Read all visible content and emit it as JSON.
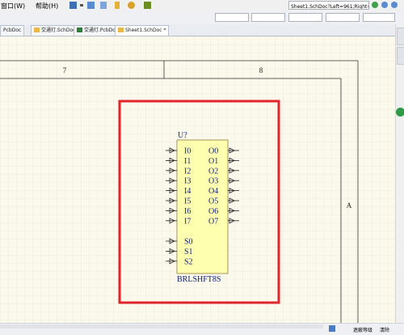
{
  "menu": {
    "window_label": "窗口(W)",
    "help_label": "帮助(H)"
  },
  "address": {
    "url": "Sheet1.SchDoc?Left=961;Right="
  },
  "tabs": [
    {
      "label": "PcbDoc"
    },
    {
      "label": "交通灯.SchDoc"
    },
    {
      "label": "交通灯.PcbDoc"
    },
    {
      "label": "Sheet1.SchDoc *"
    }
  ],
  "sheet": {
    "zone_numbers": [
      "7",
      "8"
    ],
    "zone_letter": "A"
  },
  "component": {
    "designator": "U?",
    "name": "BRLSHFT8S",
    "left_pins": [
      "I0",
      "I1",
      "I2",
      "I3",
      "I4",
      "I5",
      "I6",
      "I7"
    ],
    "select_pins": [
      "S0",
      "S1",
      "S2"
    ],
    "right_pins": [
      "O0",
      "O1",
      "O2",
      "O3",
      "O4",
      "O5",
      "O6",
      "O7"
    ]
  },
  "status": {
    "mask_level_label": "遮蔽等级",
    "clear_label": "清除"
  },
  "colors": {
    "highlight_box": "#e0252b",
    "component_fill": "#ffffb0",
    "component_text": "#0a1f7a",
    "designator_text": "#1e2f8c",
    "pin_line": "#222222"
  }
}
